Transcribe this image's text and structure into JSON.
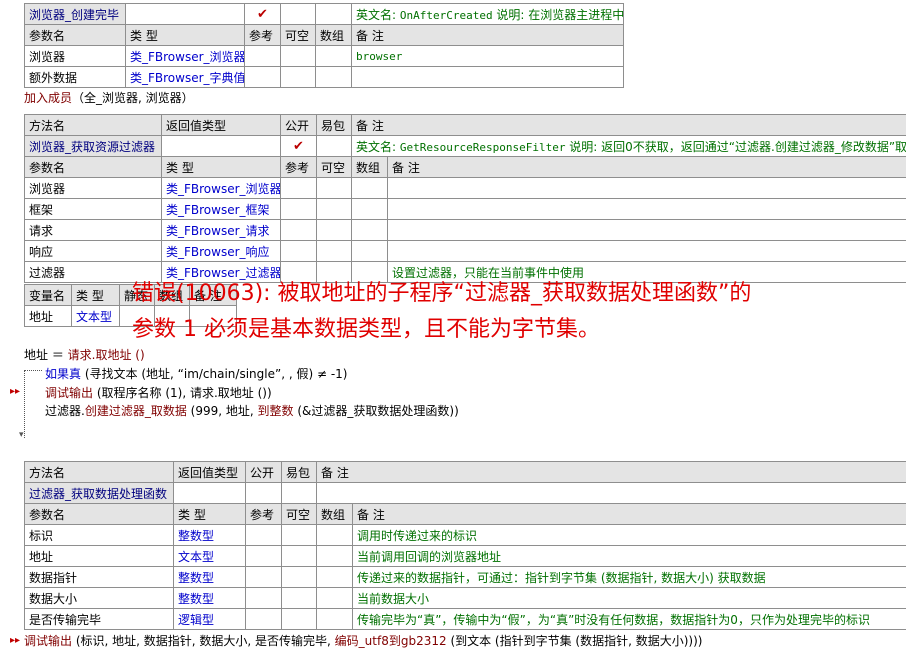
{
  "event": {
    "name": "浏览器_创建完毕",
    "check": "✔",
    "english_label": "英文名:",
    "english_name": "OnAfterCreated",
    "desc_label": "说明:",
    "desc": "在浏览器主进程中调用",
    "param_headers": [
      "参数名",
      "类 型",
      "参考",
      "可空",
      "数组",
      "备 注"
    ],
    "params": [
      {
        "name": "浏览器",
        "type": "类_FBrowser_浏览器",
        "note": "browser"
      },
      {
        "name": "额外数据",
        "type": "类_FBrowser_字典值",
        "note": ""
      }
    ]
  },
  "add_member": {
    "label": "加入成员",
    "args": "（全_浏览器, 浏览器）"
  },
  "method1": {
    "headers": [
      "方法名",
      "返回值类型",
      "公开",
      "易包",
      "备 注"
    ],
    "name": "浏览器_获取资源过滤器",
    "check": "✔",
    "english_label": "英文名:",
    "english_name": "GetResourceResponseFilter",
    "desc_label": "说明:",
    "desc": "返回0不获取，返回通过“过滤器.创建过滤器_修改数据”取",
    "param_headers": [
      "参数名",
      "类 型",
      "参考",
      "可空",
      "数组",
      "备 注"
    ],
    "params": [
      {
        "name": "浏览器",
        "type": "类_FBrowser_浏览器",
        "note": ""
      },
      {
        "name": "框架",
        "type": "类_FBrowser_框架",
        "note": ""
      },
      {
        "name": "请求",
        "type": "类_FBrowser_请求",
        "note": ""
      },
      {
        "name": "响应",
        "type": "类_FBrowser_响应",
        "note": ""
      },
      {
        "name": "过滤器",
        "type": "类_FBrowser_过滤器",
        "note": "设置过滤器，只能在当前事件中使用"
      }
    ],
    "var_headers": [
      "变量名",
      "类 型",
      "静态",
      "数组",
      "备 注"
    ],
    "vars": [
      {
        "name": "地址",
        "type": "文本型"
      }
    ]
  },
  "error": {
    "line1": "错误(10063): 被取地址的子程序“过滤器_获取数据处理函数”的",
    "line2": "参数 1 必须是基本数据类型，且不能为字节集。"
  },
  "code": {
    "l1_var": "地址",
    "l1_eq": " ＝ ",
    "l1_call": "请求.取地址 ()",
    "l2_kw": "如果真",
    "l2_rest": " (寻找文本 (地址, “im/chain/single”, , 假) ≠ -1)",
    "l3_fn": "调试输出",
    "l3_rest": " (取程序名称 (1), 请求.取地址 ())",
    "l4_obj": "过滤器.",
    "l4_fn": "创建过滤器_取数据",
    "l4_a": " (999, 地址, ",
    "l4_kw": "到整数",
    "l4_b": " (&过滤器_获取数据处理函数))"
  },
  "method2": {
    "headers": [
      "方法名",
      "返回值类型",
      "公开",
      "易包",
      "备 注"
    ],
    "name": "过滤器_获取数据处理函数",
    "param_headers": [
      "参数名",
      "类 型",
      "参考",
      "可空",
      "数组",
      "备 注"
    ],
    "params": [
      {
        "name": "标识",
        "type": "整数型",
        "note": "调用时传递过来的标识"
      },
      {
        "name": "地址",
        "type": "文本型",
        "note": "当前调用回调的浏览器地址"
      },
      {
        "name": "数据指针",
        "type": "整数型",
        "note": "传递过来的数据指针，可通过：指针到字节集 (数据指针, 数据大小) 获取数据"
      },
      {
        "name": "数据大小",
        "type": "整数型",
        "note": "当前数据大小"
      },
      {
        "name": "是否传输完毕",
        "type": "逻辑型",
        "note": "传输完毕为“真”，传输中为“假”，为“真”时没有任何数据，数据指针为0，只作为处理完毕的标识"
      }
    ]
  },
  "bottom": {
    "fn": "调试输出",
    "a": " (标识, 地址, 数据指针, 数据大小, 是否传输完毕, ",
    "fn2": "编码_utf8到gb2312",
    "b": " (到文本 (指针到字节集 (数据指针, 数据大小))))"
  }
}
